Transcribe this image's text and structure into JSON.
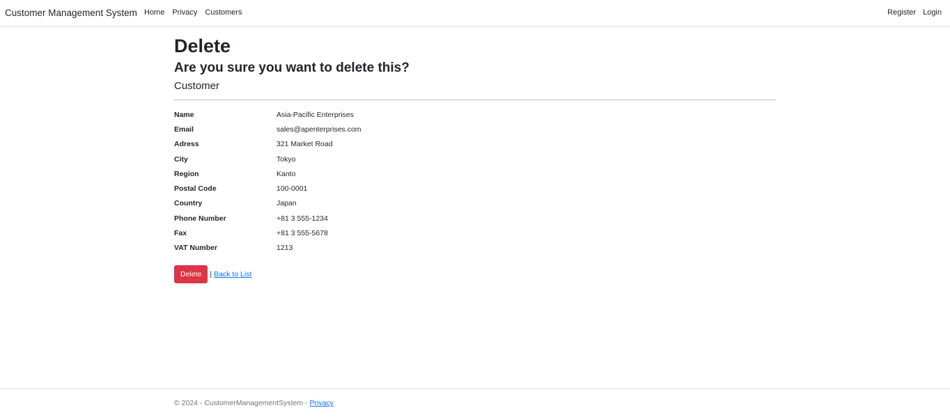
{
  "navbar": {
    "brand": "Customer Management System",
    "links": [
      "Home",
      "Privacy",
      "Customers"
    ],
    "right_links": [
      "Register",
      "Login"
    ]
  },
  "main": {
    "title": "Delete",
    "confirm": "Are you sure you want to delete this?",
    "entity": "Customer",
    "fields": [
      {
        "label": "Name",
        "value": "Asia-Pacific Enterprises"
      },
      {
        "label": "Email",
        "value": "sales@apenterprises.com"
      },
      {
        "label": "Adress",
        "value": "321 Market Road"
      },
      {
        "label": "City",
        "value": "Tokyo"
      },
      {
        "label": "Region",
        "value": "Kanto"
      },
      {
        "label": "Postal Code",
        "value": "100-0001"
      },
      {
        "label": "Country",
        "value": "Japan"
      },
      {
        "label": "Phone Number",
        "value": "+81 3 555-1234"
      },
      {
        "label": "Fax",
        "value": "+81 3 555-5678"
      },
      {
        "label": "VAT Number",
        "value": "1213"
      }
    ],
    "delete_label": "Delete",
    "separator": "|",
    "back_label": "Back to List"
  },
  "footer": {
    "text": "© 2024 - CustomerManagementSystem - ",
    "privacy_label": "Privacy"
  },
  "colors": {
    "danger": "#dc3545",
    "link": "#0d6efd"
  }
}
